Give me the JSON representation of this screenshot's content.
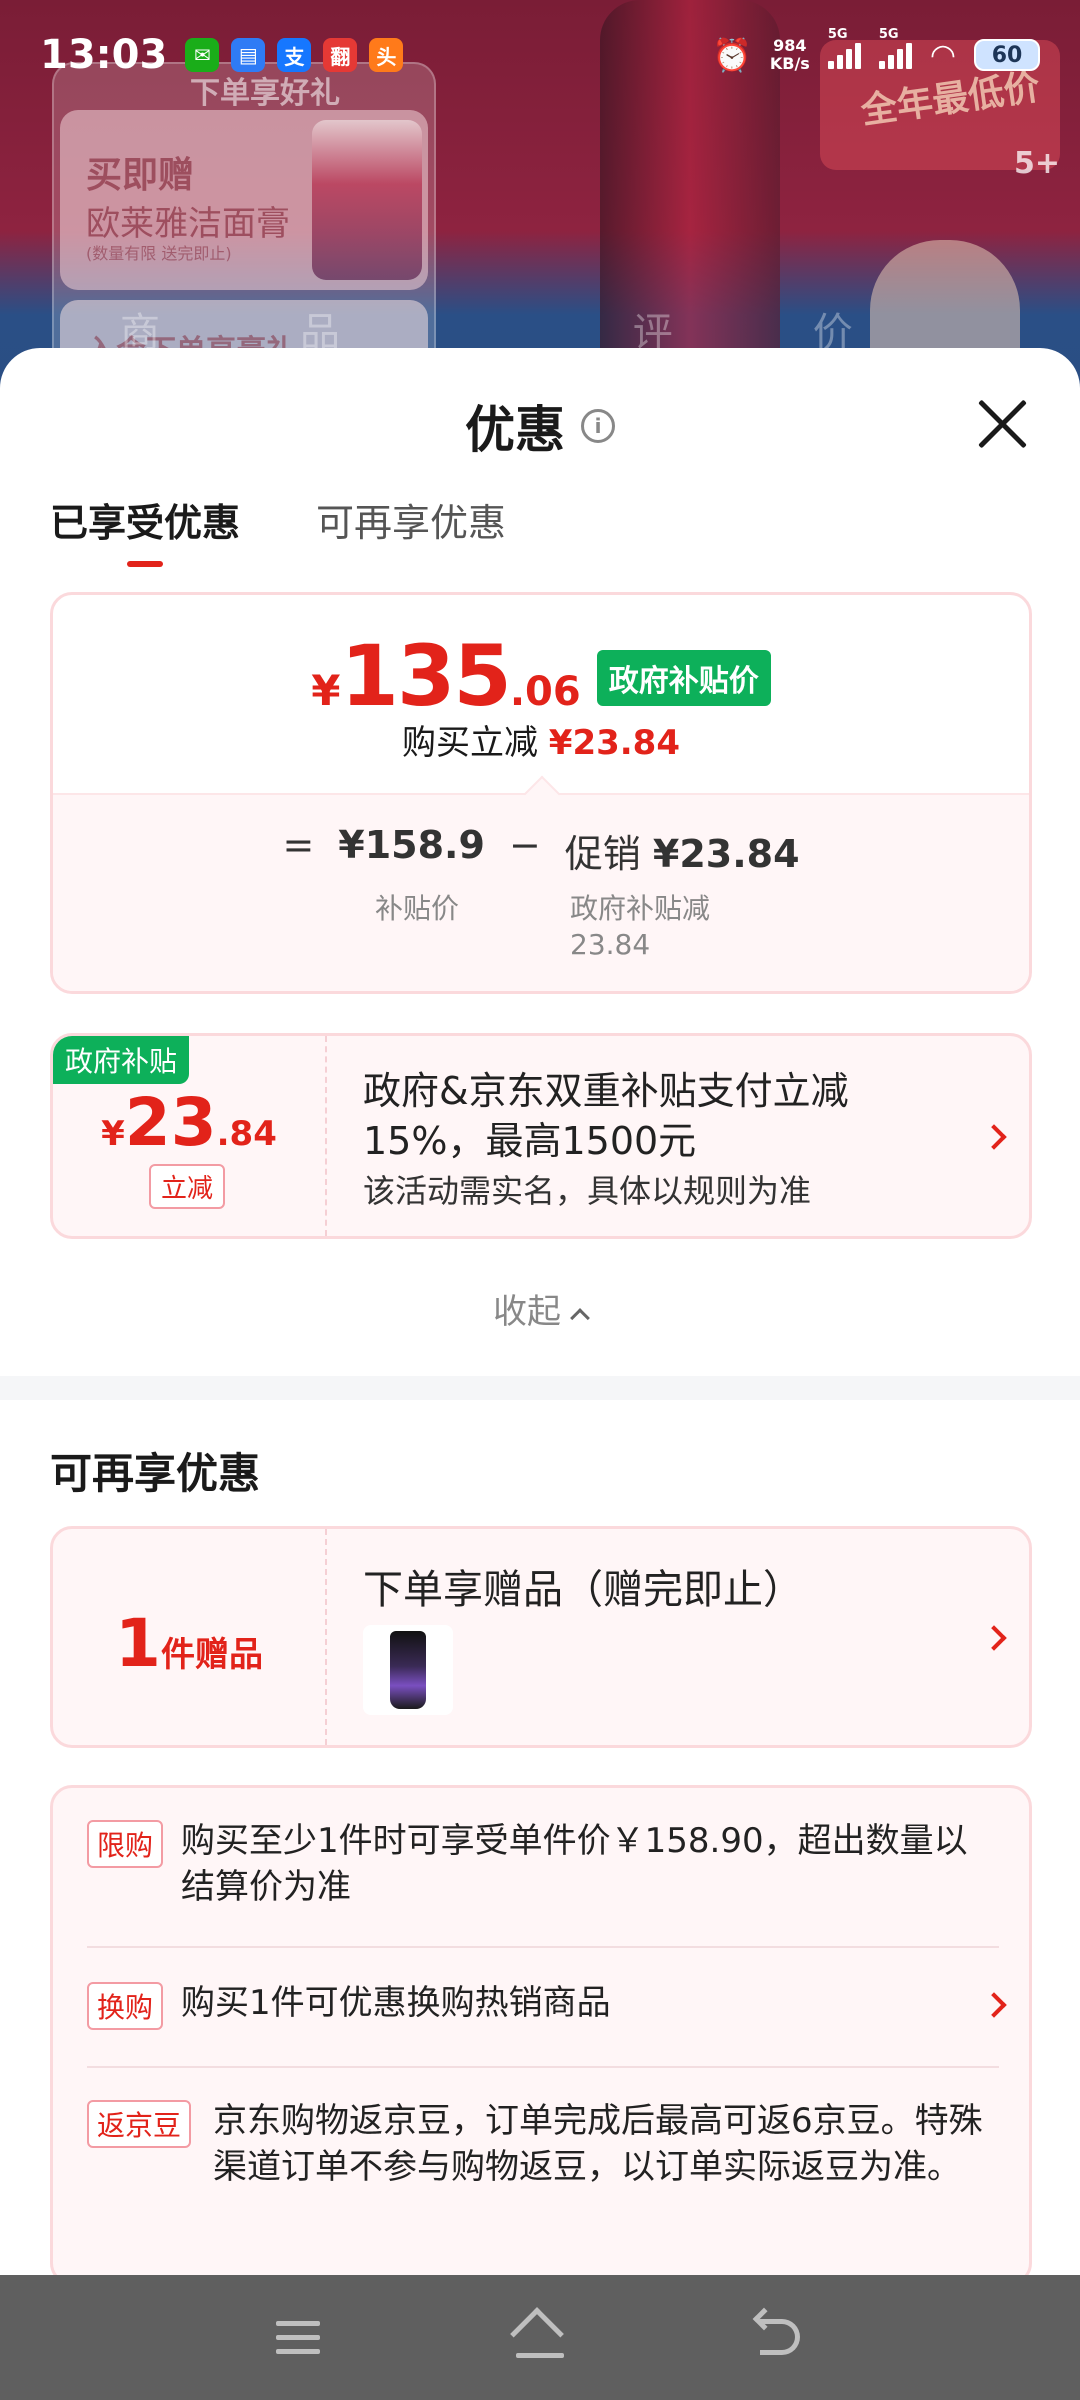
{
  "status_bar": {
    "time": "13:03",
    "net_speed_value": "984",
    "net_speed_unit": "KB/s",
    "sim1": "5G",
    "sim2": "5G",
    "battery": "60",
    "app_icons": [
      "wechat-icon",
      "message-icon",
      "alipay-icon",
      "app-icon",
      "app-icon"
    ]
  },
  "background": {
    "gift_header": "下单享好礼",
    "gift_main": "买即赠",
    "gift_sub": "欧莱雅洁面膏",
    "gift_tiny": "(数量有限 送完即止)",
    "gift_main2": "入会下单享豪礼",
    "promo": "全年最低价",
    "badge": "5+",
    "menu": "商品 评价 详情 推荐"
  },
  "sheet": {
    "title": "优惠",
    "tabs": [
      {
        "label": "已享受优惠",
        "active": true
      },
      {
        "label": "可再享优惠",
        "active": false
      }
    ],
    "summary": {
      "currency": "¥",
      "price_int": "135",
      "price_dec": ".06",
      "price_tag": "政府补贴价",
      "reduce_label": "购买立减",
      "reduce_value": "¥23.84",
      "formula_eq": "=",
      "formula_base": "¥158.9",
      "formula_minus": "−",
      "formula_promo_label": "促销",
      "formula_promo_value": "¥23.84",
      "base_label": "补贴价",
      "promo_sub_label": "政府补贴减",
      "promo_sub_value": "23.84"
    },
    "discount": {
      "corner_tag": "政府补贴",
      "currency": "¥",
      "amount_int": "23",
      "amount_dec": ".84",
      "type": "立减",
      "desc": "政府&京东双重补贴支付立减15%，最高1500元",
      "note": "该活动需实名，具体以规则为准"
    },
    "collapse_label": "收起",
    "section_title": "可再享优惠",
    "gift": {
      "count_num": "1",
      "count_text": "件赠品",
      "title": "下单享赠品（赠完即止）"
    },
    "rules": [
      {
        "tag": "限购",
        "text": "购买至少1件时可享受单件价￥158.90，超出数量以结算价为准"
      },
      {
        "tag": "换购",
        "text": "购买1件可优惠换购热销商品"
      },
      {
        "tag": "返京豆",
        "text": "京东购物返京豆，订单完成后最高可返6京豆。特殊渠道订单不参与购物返豆，以订单实际返豆为准。"
      }
    ]
  },
  "colors": {
    "accent_red": "#e2231a",
    "gov_green": "#0db05a",
    "card_border": "#fbd9dc",
    "card_bg": "#fff6f7",
    "navbar": "#5f5f5f"
  }
}
